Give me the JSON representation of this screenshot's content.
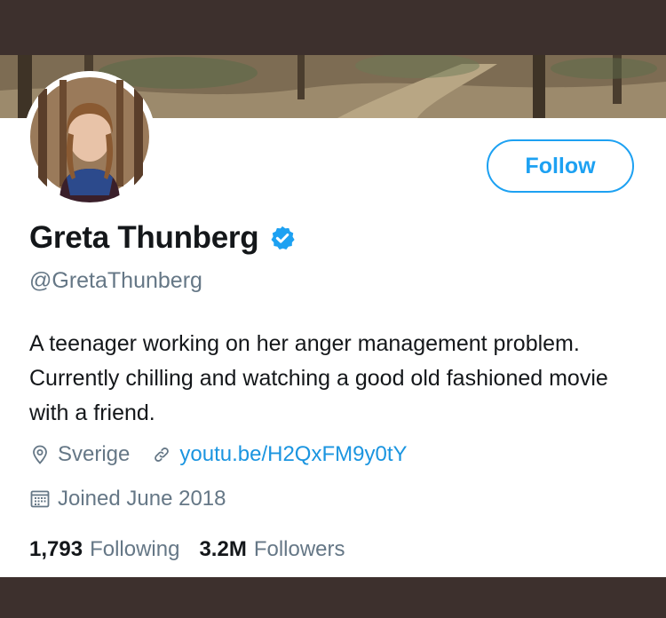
{
  "profile": {
    "display_name": "Greta Thunberg",
    "handle": "@GretaThunberg",
    "bio": "A teenager working on her anger management problem. Currently chilling and watching a good old fashioned movie with a friend.",
    "location": "Sverige",
    "website": "youtu.be/H2QxFM9y0tY",
    "joined": "Joined June 2018",
    "following_count": "1,793",
    "following_label": "Following",
    "followers_count": "3.2M",
    "followers_label": "Followers",
    "verified": true
  },
  "actions": {
    "follow_label": "Follow"
  },
  "icons": {
    "verified": "verified-badge-icon",
    "location": "location-pin-icon",
    "link": "link-icon",
    "calendar": "calendar-icon"
  },
  "colors": {
    "accent": "#1da1f2",
    "link": "#1b95e0",
    "text_primary": "#14171a",
    "text_secondary": "#657786",
    "frame": "#3d302d"
  }
}
